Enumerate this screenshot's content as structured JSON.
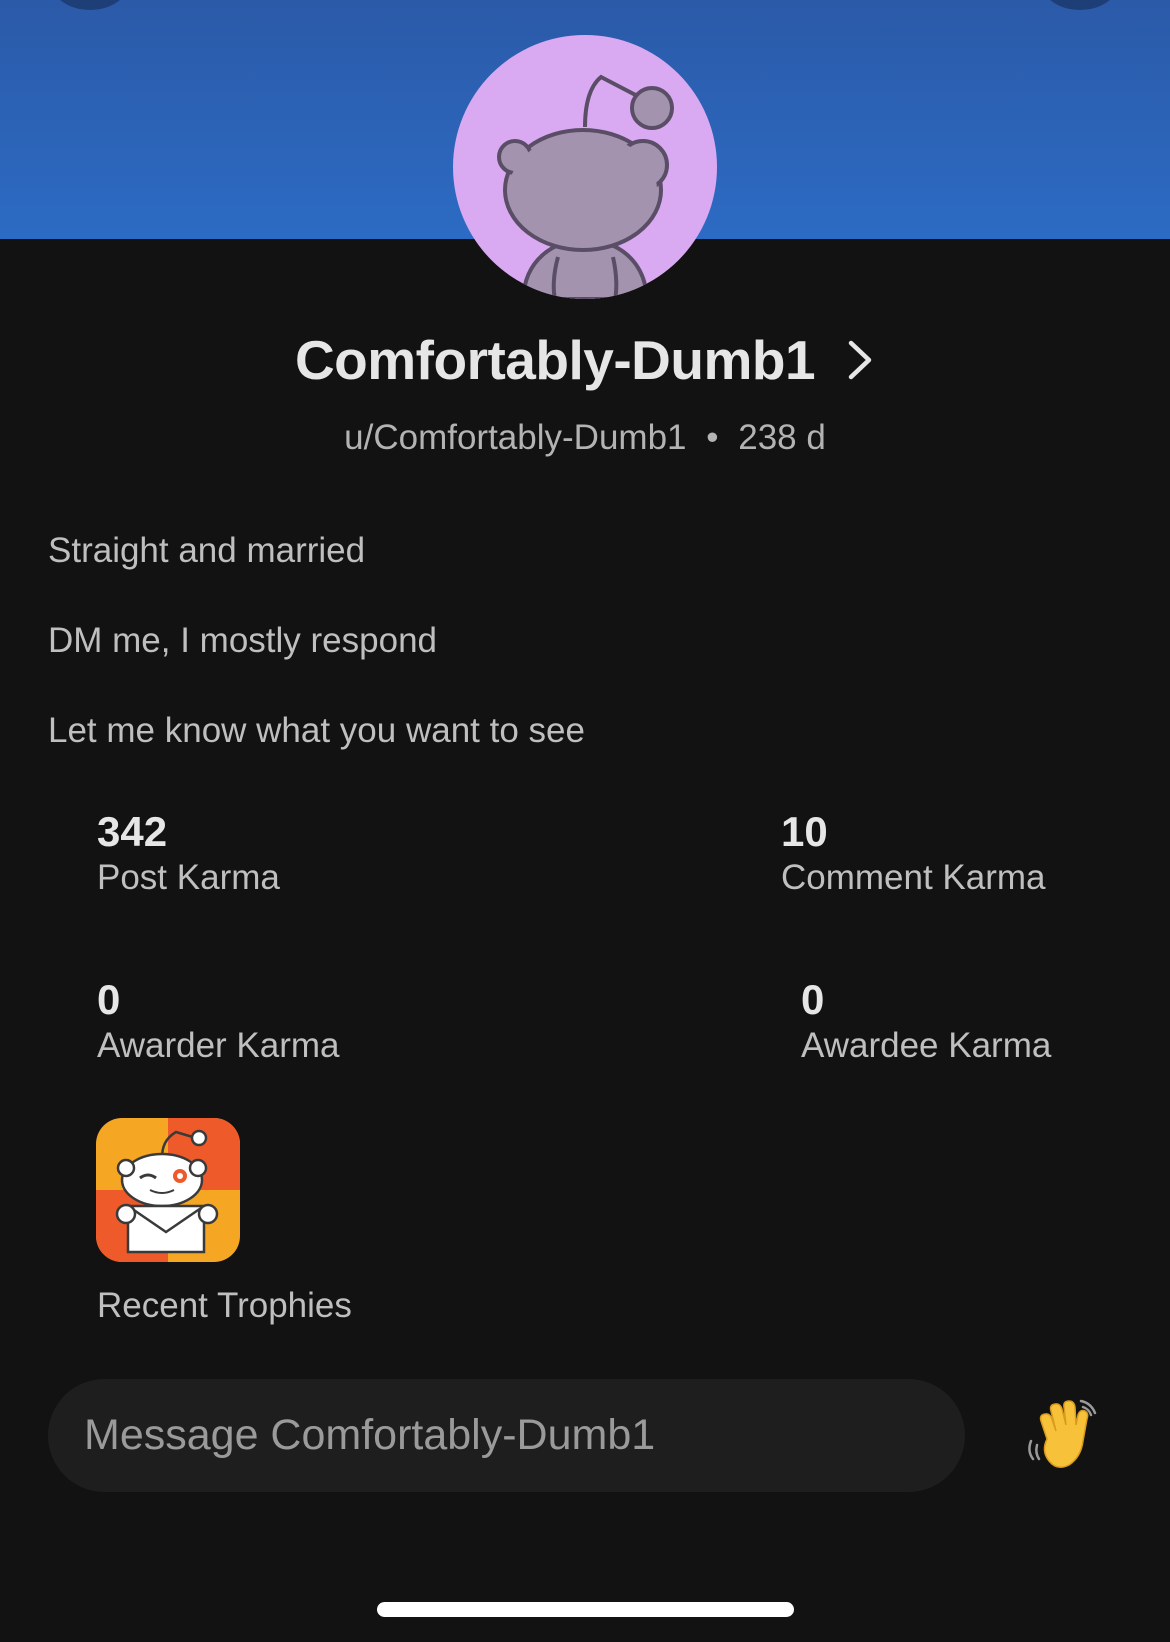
{
  "profile": {
    "display_name": "Comfortably-Dumb1",
    "username": "u/Comfortably-Dumb1",
    "separator": "•",
    "account_age": "238 d",
    "banner_color": "#2c64b8",
    "avatar_bg_color": "#d9aaf2"
  },
  "bio": {
    "lines": [
      "Straight and married",
      "DM me, I mostly respond",
      "Let me know what you want to see"
    ]
  },
  "stats": {
    "post_karma": {
      "value": "342",
      "label": "Post Karma"
    },
    "comment_karma": {
      "value": "10",
      "label": "Comment Karma"
    },
    "awarder_karma": {
      "value": "0",
      "label": "Awarder Karma"
    },
    "awardee_karma": {
      "value": "0",
      "label": "Awardee Karma"
    }
  },
  "trophies": {
    "label": "Recent Trophies",
    "items": [
      {
        "icon": "verified-email-trophy-icon"
      }
    ]
  },
  "message": {
    "placeholder": "Message Comfortably-Dumb1",
    "wave_icon": "waving-hand-icon"
  }
}
